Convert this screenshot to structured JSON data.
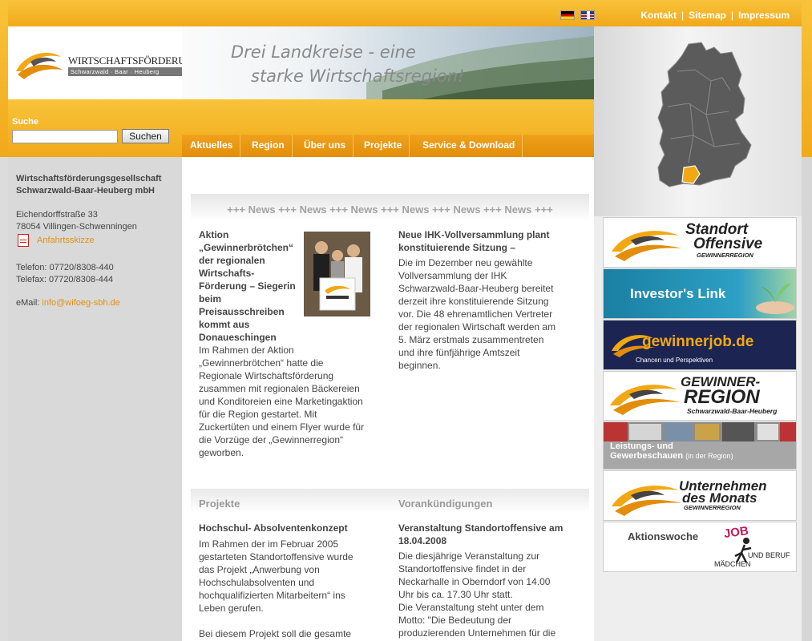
{
  "topbar": {
    "links": [
      "Kontakt",
      "Sitemap",
      "Impressum"
    ],
    "separator": "|"
  },
  "logo": {
    "name": "WIRTSCHAFTSFÖRDERUNG",
    "subtitle": "Schwarzwald · Baar · Heuberg"
  },
  "banner": {
    "line1": "Drei Landkreise - eine",
    "line2": "starke Wirtschaftsregion!"
  },
  "search": {
    "label": "Suche",
    "value": "",
    "button": "Suchen"
  },
  "nav": {
    "items": [
      "Aktuelles",
      "Region",
      "Über uns",
      "Projekte",
      "Service & Download"
    ]
  },
  "sidebar": {
    "company_line1": "Wirtschaftsförderungsgesellschaft",
    "company_line2": "Schwarzwald-Baar-Heuberg mbH",
    "street": "Eichendorffstraße 33",
    "city": "78054 Villingen-Schwenningen",
    "directions_link": "Anfahrtsskizze",
    "phone": "Telefon: 07720/8308-440",
    "fax": "Telefax: 07720/8308-444",
    "email_label": "eMail: ",
    "email": "info@wifoeg-sbh.de"
  },
  "news": {
    "ticker": "+++ News +++ News +++ News +++ News +++ News +++ News +++",
    "item1": {
      "title": [
        "Aktion",
        "„Gewinnerbrötchen“",
        "der regionalen",
        "Wirtschafts-",
        "Förderung – Siegerin",
        "beim",
        "Preisausschreiben",
        "kommt aus",
        "Donaueschingen"
      ],
      "text": [
        "Im Rahmen der Aktion",
        "„Gewinnerbrötchen“ hatte die",
        "Regionale Wirtschaftsförderung",
        "zusammen mit regionalen Bäckereien",
        "und Konditoreien eine Marketingaktion",
        "für die Region gestartet. Mit",
        "Zuckertüten und einem Flyer wurde für",
        "die Vorzüge der „Gewinnerregion“",
        "geworben."
      ]
    },
    "item2": {
      "title": [
        "Neue IHK-Vollversammlung plant",
        "konstituierende Sitzung –"
      ],
      "text": [
        "Die im Dezember neu gewählte",
        "Vollversammlung der IHK",
        "Schwarzwald-Baar-Heuberg bereitet",
        "derzeit ihre konstituierende Sitzung",
        "vor. Die 48 ehrenamtlichen Vertreter",
        "der regionalen Wirtschaft werden am",
        "5. März erstmals zusammentreten",
        "und ihre fünfjährige Amtszeit",
        "beginnen."
      ]
    }
  },
  "projekte": {
    "heading": "Projekte",
    "title": "Hochschul- Absolventenkonzept",
    "text": [
      "Im Rahmen der im Februar 2005",
      "gestarteten Standortoffensive wurde",
      "das Projekt „Anwerbung von",
      "Hochschulabsolventen und",
      "hochqualifizierten Mitarbeitern“ ins",
      "Leben gerufen.",
      "",
      "Bei diesem Projekt soll die gesamte"
    ]
  },
  "vorankuendigungen": {
    "heading": "Vorankündigungen",
    "title": [
      "Veranstaltung Standortoffensive am",
      "18.04.2008"
    ],
    "text": [
      "Die diesjährige Veranstaltung zur",
      "Standortoffensive findet in der",
      "Neckarhalle in Oberndorf von 14.00",
      "Uhr bis ca. 17.30 Uhr statt.",
      "Die Veranstaltung steht unter dem",
      "Motto: \"Die Bedeutung der",
      "produzierenden Unternehmen für die"
    ]
  },
  "ads": {
    "standort": {
      "line1": "Standort",
      "line2": "Offensive",
      "line3": "GEWINNERREGION"
    },
    "investor": {
      "label": "Investor's Link"
    },
    "job": {
      "label": "gewinnerjob.de",
      "sub": "Chancen und Perspektiven"
    },
    "region": {
      "line1": "GEWINNER-",
      "line2": "REGION",
      "line3": "Schwarzwald-Baar-Heuberg"
    },
    "leistung": {
      "line1": "Leistungs- und",
      "line2": "Gewerbeschauen",
      "suffix": "(in der Region)"
    },
    "unternehmen": {
      "line1": "Unternehmen",
      "line2": "des Monats",
      "line3": "GEWINNERREGION"
    },
    "aktion": {
      "label": "Aktionswoche",
      "logo_text": "JOB",
      "tag1": "UND BERUF",
      "tag2": "MÄDCHEN"
    }
  },
  "colors": {
    "orange_light": "#f8c33a",
    "orange_dark": "#e28e0b",
    "link": "#e0920f",
    "navy": "#1c2552",
    "teal": "#1e8fb0"
  }
}
